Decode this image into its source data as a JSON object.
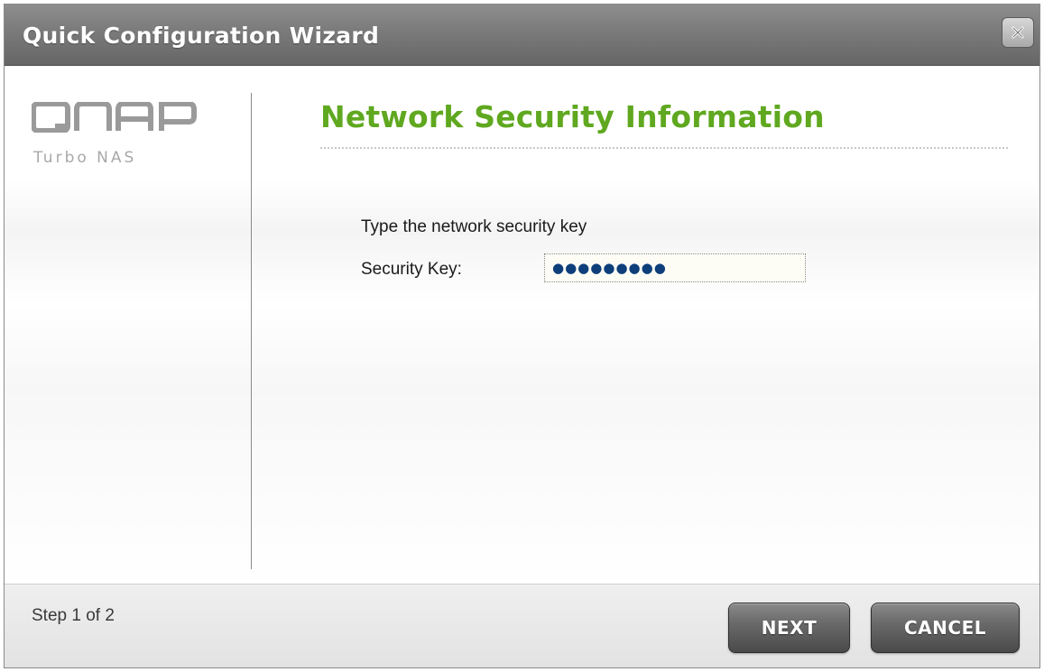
{
  "window": {
    "title": "Quick Configuration Wizard",
    "close_icon": "close-icon"
  },
  "branding": {
    "logo_text": "QNAP",
    "subtitle": "Turbo NAS",
    "logo_color": "#9a9a9a"
  },
  "content": {
    "heading": "Network Security Information",
    "heading_color": "#5fa81f",
    "instruction": "Type the network security key",
    "security_key": {
      "label": "Security Key:",
      "masked_value": "●●●●●●●●●"
    }
  },
  "footer": {
    "step": "Step 1 of 2",
    "next_label": "NEXT",
    "cancel_label": "CANCEL"
  }
}
